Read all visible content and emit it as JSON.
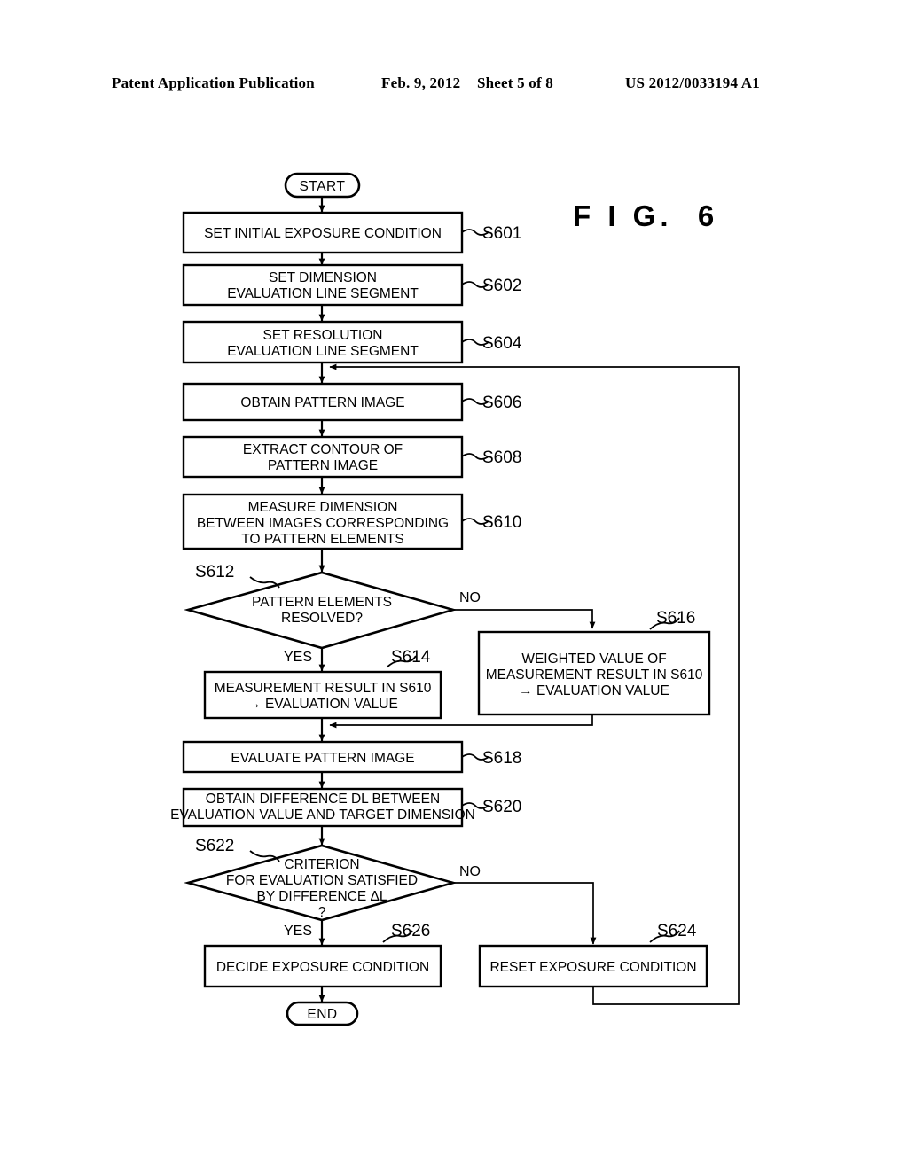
{
  "header": {
    "publication": "Patent Application Publication",
    "date": "Feb. 9, 2012",
    "sheet": "Sheet 5 of 8",
    "number": "US 2012/0033194 A1"
  },
  "figure": {
    "label": "F I G.  6"
  },
  "flowchart": {
    "terminators": {
      "start": "START",
      "end": "END"
    },
    "branch_labels": {
      "no_1": "NO",
      "yes_1": "YES",
      "no_2": "NO",
      "yes_2": "YES"
    },
    "nodes": [
      {
        "id": "S601",
        "step": "S601",
        "type": "process",
        "lines": [
          "SET INITIAL EXPOSURE CONDITION"
        ]
      },
      {
        "id": "S602",
        "step": "S602",
        "type": "process",
        "lines": [
          "SET DIMENSION",
          "EVALUATION LINE SEGMENT"
        ]
      },
      {
        "id": "S604",
        "step": "S604",
        "type": "process",
        "lines": [
          "SET RESOLUTION",
          "EVALUATION LINE SEGMENT"
        ]
      },
      {
        "id": "S606",
        "step": "S606",
        "type": "process",
        "lines": [
          "OBTAIN PATTERN IMAGE"
        ]
      },
      {
        "id": "S608",
        "step": "S608",
        "type": "process",
        "lines": [
          "EXTRACT CONTOUR OF",
          "PATTERN IMAGE"
        ]
      },
      {
        "id": "S610",
        "step": "S610",
        "type": "process",
        "lines": [
          "MEASURE DIMENSION",
          "BETWEEN IMAGES CORRESPONDING",
          "TO PATTERN ELEMENTS"
        ]
      },
      {
        "id": "S612",
        "step": "S612",
        "type": "decision",
        "lines": [
          "PATTERN ELEMENTS",
          "RESOLVED?"
        ]
      },
      {
        "id": "S614",
        "step": "S614",
        "type": "process",
        "lines": [
          "MEASUREMENT RESULT IN S610",
          "→ EVALUATION VALUE"
        ]
      },
      {
        "id": "S616",
        "step": "S616",
        "type": "process",
        "lines": [
          "WEIGHTED VALUE OF",
          "MEASUREMENT RESULT IN S610",
          "→ EVALUATION VALUE"
        ]
      },
      {
        "id": "S618",
        "step": "S618",
        "type": "process",
        "lines": [
          "EVALUATE PATTERN IMAGE"
        ]
      },
      {
        "id": "S620",
        "step": "S620",
        "type": "process",
        "lines": [
          "OBTAIN DIFFERENCE DL BETWEEN",
          "EVALUATION VALUE AND TARGET DIMENSION"
        ]
      },
      {
        "id": "S622",
        "step": "S622",
        "type": "decision",
        "lines": [
          "CRITERION",
          "FOR EVALUATION SATISFIED",
          "BY DIFFERENCE ΔL",
          "?"
        ]
      },
      {
        "id": "S624",
        "step": "S624",
        "type": "process",
        "lines": [
          "RESET EXPOSURE CONDITION"
        ]
      },
      {
        "id": "S626",
        "step": "S626",
        "type": "process",
        "lines": [
          "DECIDE EXPOSURE CONDITION"
        ]
      }
    ]
  },
  "colors": {
    "ink": "#000000",
    "paper": "#ffffff"
  }
}
